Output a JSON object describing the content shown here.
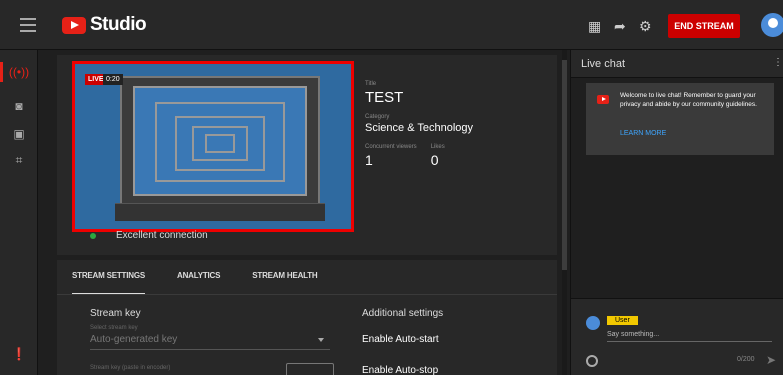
{
  "app": {
    "title": "Studio"
  },
  "topbar": {
    "end_stream_label": "END STREAM"
  },
  "preview": {
    "live_badge": "LIVE",
    "live_time": "0:20",
    "connection": "Excellent connection"
  },
  "meta": {
    "title_label": "Title",
    "title_value": "TEST",
    "category_label": "Category",
    "category_value": "Science & Technology",
    "viewers_label": "Concurrent viewers",
    "viewers_value": "1",
    "likes_label": "Likes",
    "likes_value": "0"
  },
  "tabs": [
    {
      "label": "STREAM SETTINGS"
    },
    {
      "label": "ANALYTICS"
    },
    {
      "label": "STREAM HEALTH"
    }
  ],
  "stream_key": {
    "title": "Stream key",
    "select_label": "Select stream key",
    "select_value": "Auto-generated key",
    "footer_label": "Stream key (paste in encoder)"
  },
  "additional": {
    "title": "Additional settings",
    "item1": "Enable Auto-start",
    "item2": "Enable Auto-stop"
  },
  "chat": {
    "title": "Live chat",
    "welcome_text": "Welcome to live chat! Remember to guard your privacy and abide by our community guidelines.",
    "learn_more": "LEARN MORE",
    "user_name": "User",
    "input_placeholder": "Say something...",
    "char_count": "0/200"
  },
  "colors": {
    "accent": "#cc0000",
    "link": "#3ea6ff",
    "status_good": "#2ba640"
  }
}
